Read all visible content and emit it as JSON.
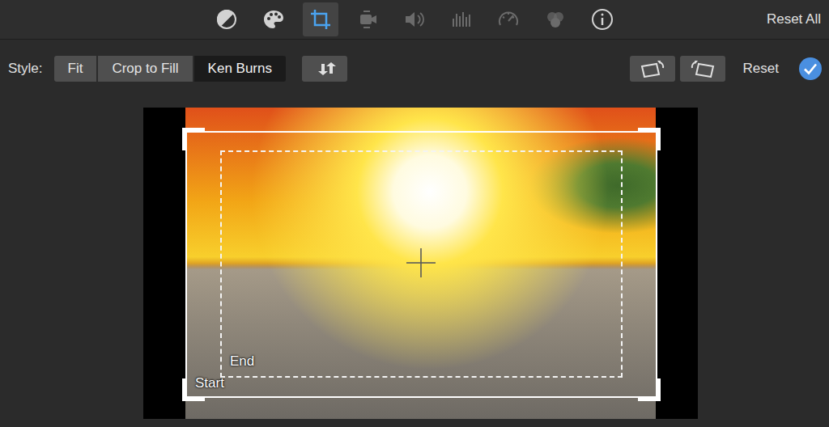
{
  "toolbar": {
    "tools": [
      {
        "kind": "color-balance",
        "selected": false,
        "disabled": false
      },
      {
        "kind": "color-correction",
        "selected": false,
        "disabled": false
      },
      {
        "kind": "crop",
        "selected": true,
        "disabled": false
      },
      {
        "kind": "stabilization",
        "selected": false,
        "disabled": true
      },
      {
        "kind": "volume",
        "selected": false,
        "disabled": true
      },
      {
        "kind": "noise-reduction",
        "selected": false,
        "disabled": true
      },
      {
        "kind": "speed",
        "selected": false,
        "disabled": true
      },
      {
        "kind": "clip-filter",
        "selected": false,
        "disabled": true
      },
      {
        "kind": "info",
        "selected": false,
        "disabled": false
      }
    ],
    "reset_all": "Reset All"
  },
  "style_bar": {
    "label": "Style:",
    "options": [
      {
        "label": "Fit",
        "selected": false
      },
      {
        "label": "Crop to Fill",
        "selected": false
      },
      {
        "label": "Ken Burns",
        "selected": true
      }
    ],
    "reset": "Reset"
  },
  "viewer": {
    "start_label": "Start",
    "end_label": "End"
  }
}
